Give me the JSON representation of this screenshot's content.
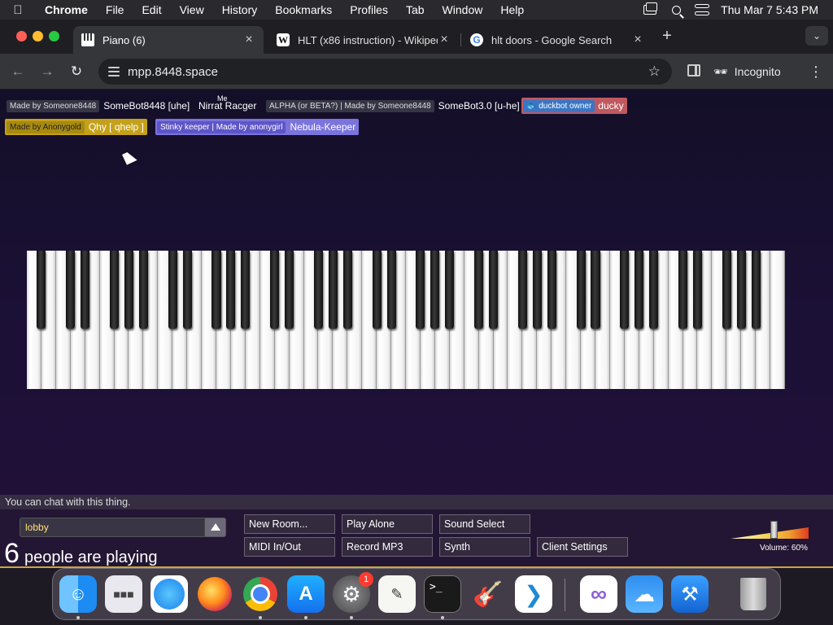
{
  "menubar": {
    "apple_icon": "apple-icon",
    "items": [
      "Chrome",
      "File",
      "Edit",
      "View",
      "History",
      "Bookmarks",
      "Profiles",
      "Tab",
      "Window",
      "Help"
    ],
    "clock": "Thu Mar 7  5:43 PM"
  },
  "tabs": [
    {
      "title": "Piano (6)",
      "icon": "piano-favicon",
      "active": true
    },
    {
      "title": "HLT (x86 instruction) - Wikipedia",
      "icon": "wikipedia-favicon",
      "active": false
    },
    {
      "title": "hlt doors - Google Search",
      "icon": "google-favicon",
      "active": false
    }
  ],
  "toolbar": {
    "url": "mpp.8448.space",
    "incognito_label": "Incognito"
  },
  "nametags": {
    "bot1_label": "Made by Someone8448",
    "bot1_name": "SomeBot8448 [uhe]",
    "me_label": "Me",
    "user_name": "Nirrat Racger",
    "bot2_label": "ALPHA (or BETA?) | Made by Someone8448",
    "bot2_name": "SomeBot3.0 [u-he]",
    "duck_label": "duckbot owner",
    "duck_name": "ducky",
    "qhy_label": "Made by Anonygold",
    "qhy_name": "Qhy [ qhelp ]",
    "nebula_label": "Stinky keeper | Made by anonygirl",
    "nebula_name": "Nebula-Keeper"
  },
  "piano": {
    "white_keys": 52,
    "black_key_pattern": [
      1,
      0,
      1,
      1,
      0,
      1,
      1,
      1
    ]
  },
  "chat": {
    "hint": "You can chat with this thing."
  },
  "room": {
    "selected": "lobby"
  },
  "players": {
    "count": "6",
    "text": "people are playing"
  },
  "buttons": {
    "new_room": "New Room...",
    "play_alone": "Play Alone",
    "sound_select": "Sound Select",
    "midi": "MIDI In/Out",
    "record": "Record MP3",
    "synth": "Synth",
    "client_settings": "Client Settings"
  },
  "volume": {
    "label": "Volume: 60%",
    "level": 0.6
  },
  "dock": {
    "items": [
      "Finder",
      "Launchpad",
      "Safari",
      "Firefox",
      "Google Chrome",
      "App Store",
      "System Settings",
      "TextEdit",
      "Terminal",
      "GarageBand",
      "Visual Studio Code",
      "Visual Studio",
      "Weather",
      "Xcode",
      "Trash"
    ],
    "settings_badge": "1"
  }
}
